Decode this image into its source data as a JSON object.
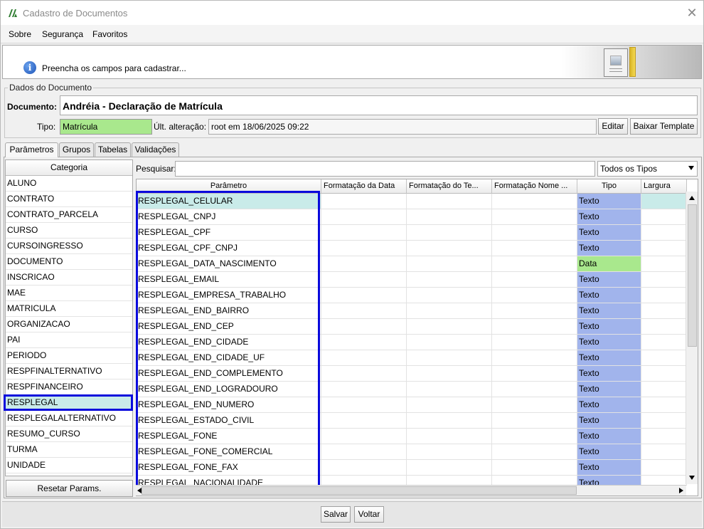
{
  "window": {
    "title": "Cadastro de Documentos",
    "close_glyph": "✕"
  },
  "menu": {
    "items": [
      "Sobre",
      "Segurança",
      "Favoritos"
    ]
  },
  "banner": {
    "message": "Preencha os campos para cadastrar..."
  },
  "group": {
    "title": "Dados do Documento",
    "documento_label": "Documento:",
    "documento_value": "Andréia - Declaração de Matrícula",
    "tipo_label": "Tipo:",
    "tipo_value": "Matrícula",
    "alteracao_label": "Últ. alteração:",
    "alteracao_value": "root em 18/06/2025 09:22",
    "editar_label": "Editar",
    "baixar_label": "Baixar Template"
  },
  "tabs": [
    "Parâmetros",
    "Grupos",
    "Tabelas",
    "Validações"
  ],
  "categories": {
    "header": "Categoria",
    "items": [
      "ALUNO",
      "CONTRATO",
      "CONTRATO_PARCELA",
      "CURSO",
      "CURSOINGRESSO",
      "DOCUMENTO",
      "INSCRICAO",
      "MAE",
      "MATRICULA",
      "ORGANIZACAO",
      "PAI",
      "PERIODO",
      "RESPFINALTERNATIVO",
      "RESPFINANCEIRO",
      "RESPLEGAL",
      "RESPLEGALALTERNATIVO",
      "RESUMO_CURSO",
      "TURMA",
      "UNIDADE"
    ],
    "selected": "RESPLEGAL",
    "reset_label": "Resetar Params."
  },
  "search": {
    "label": "Pesquisar:",
    "value": "",
    "filter_value": "Todos os Tipos"
  },
  "grid": {
    "columns": [
      "Parâmetro",
      "Formatação da Data",
      "Formatação do Te...",
      "Formatação Nome ...",
      "Tipo",
      "Largura"
    ],
    "rows": [
      {
        "param": "RESPLEGAL_CELULAR",
        "tipo": "Texto"
      },
      {
        "param": "RESPLEGAL_CNPJ",
        "tipo": "Texto"
      },
      {
        "param": "RESPLEGAL_CPF",
        "tipo": "Texto"
      },
      {
        "param": "RESPLEGAL_CPF_CNPJ",
        "tipo": "Texto"
      },
      {
        "param": "RESPLEGAL_DATA_NASCIMENTO",
        "tipo": "Data"
      },
      {
        "param": "RESPLEGAL_EMAIL",
        "tipo": "Texto"
      },
      {
        "param": "RESPLEGAL_EMPRESA_TRABALHO",
        "tipo": "Texto"
      },
      {
        "param": "RESPLEGAL_END_BAIRRO",
        "tipo": "Texto"
      },
      {
        "param": "RESPLEGAL_END_CEP",
        "tipo": "Texto"
      },
      {
        "param": "RESPLEGAL_END_CIDADE",
        "tipo": "Texto"
      },
      {
        "param": "RESPLEGAL_END_CIDADE_UF",
        "tipo": "Texto"
      },
      {
        "param": "RESPLEGAL_END_COMPLEMENTO",
        "tipo": "Texto"
      },
      {
        "param": "RESPLEGAL_END_LOGRADOURO",
        "tipo": "Texto"
      },
      {
        "param": "RESPLEGAL_END_NUMERO",
        "tipo": "Texto"
      },
      {
        "param": "RESPLEGAL_ESTADO_CIVIL",
        "tipo": "Texto"
      },
      {
        "param": "RESPLEGAL_FONE",
        "tipo": "Texto"
      },
      {
        "param": "RESPLEGAL_FONE_COMERCIAL",
        "tipo": "Texto"
      },
      {
        "param": "RESPLEGAL_FONE_FAX",
        "tipo": "Texto"
      },
      {
        "param": "RESPLEGAL_NACIONALIDADE",
        "tipo": "Texto"
      }
    ]
  },
  "footer": {
    "salvar_label": "Salvar",
    "voltar_label": "Voltar"
  },
  "colors": {
    "texto": "#a1b4ec",
    "data": "#a9e88d",
    "selected": "#c9ebe9",
    "highlight_border": "#0a0adc"
  }
}
